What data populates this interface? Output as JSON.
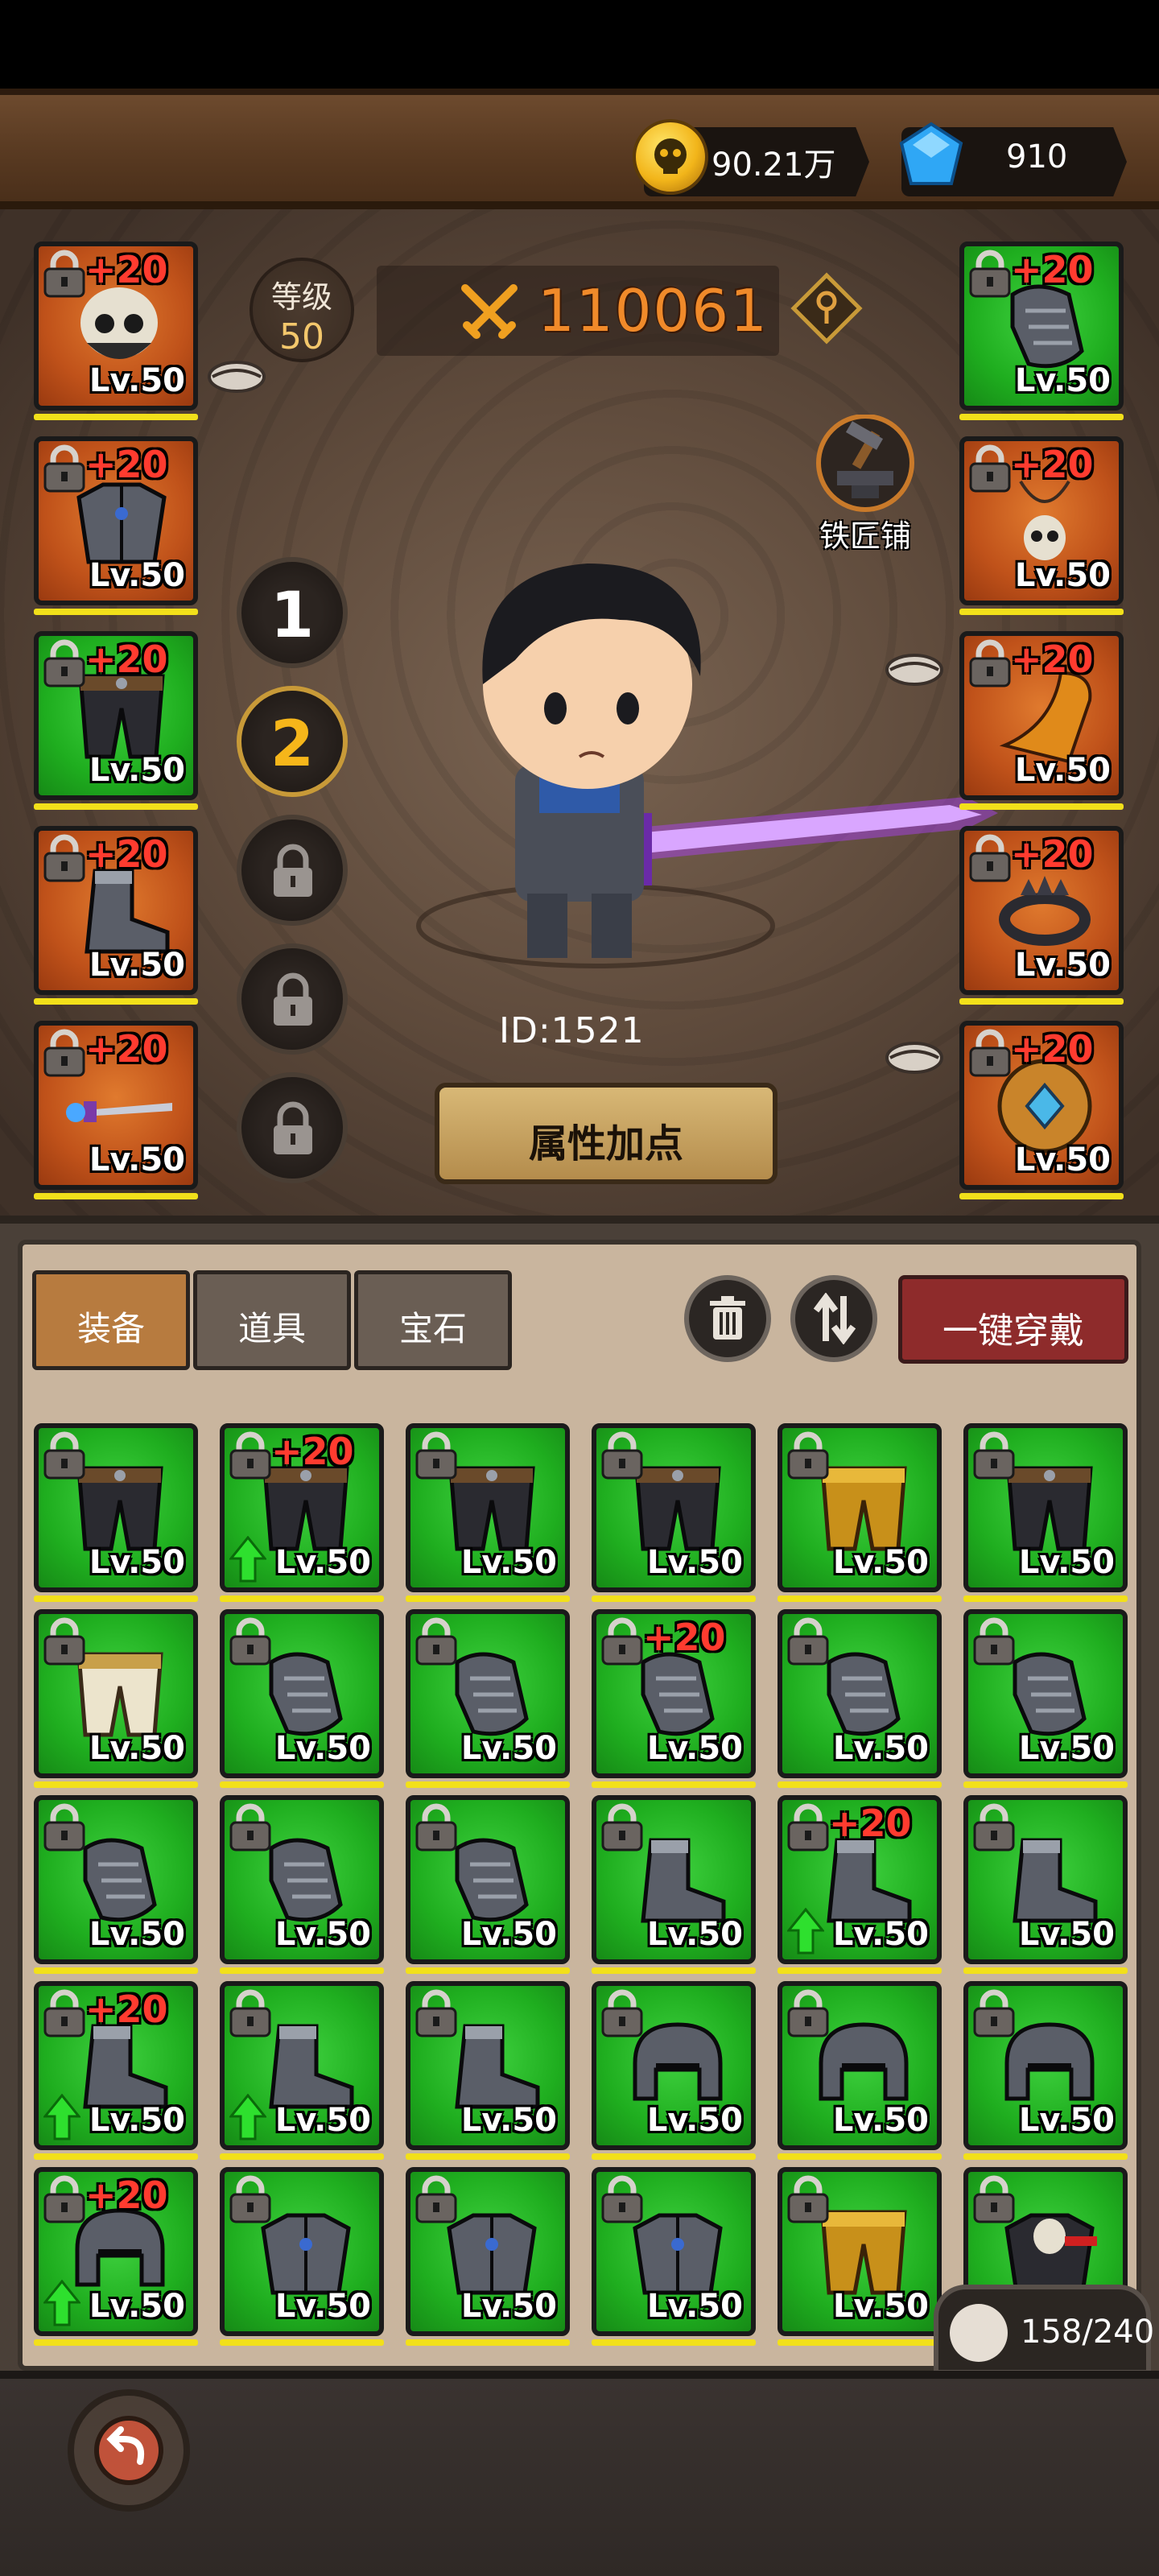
{
  "resources": {
    "gold": "90.21万",
    "gems": "910"
  },
  "hero": {
    "level_label": "等级",
    "level_value": "50",
    "combat_power": "110061",
    "id_text": "ID:1521",
    "attr_button": "属性加点",
    "blacksmith_label": "铁匠铺"
  },
  "presets": [
    "1",
    "2"
  ],
  "left_slots": [
    {
      "plus": "+20",
      "level": "Lv.50",
      "color": "orange",
      "icon": "skull-helmet-icon"
    },
    {
      "plus": "+20",
      "level": "Lv.50",
      "color": "orange",
      "icon": "chest-armor-icon"
    },
    {
      "plus": "+20",
      "level": "Lv.50",
      "color": "green",
      "icon": "pants-icon"
    },
    {
      "plus": "+20",
      "level": "Lv.50",
      "color": "orange",
      "icon": "boots-icon"
    },
    {
      "plus": "+20",
      "level": "Lv.50",
      "color": "orange",
      "icon": "sword-icon"
    }
  ],
  "right_slots": [
    {
      "plus": "+20",
      "level": "Lv.50",
      "color": "green",
      "icon": "gauntlet-icon"
    },
    {
      "plus": "+20",
      "level": "Lv.50",
      "color": "orange",
      "icon": "skull-necklace-icon"
    },
    {
      "plus": "+20",
      "level": "Lv.50",
      "color": "orange",
      "icon": "cape-icon"
    },
    {
      "plus": "+20",
      "level": "Lv.50",
      "color": "orange",
      "icon": "spiked-ring-icon"
    },
    {
      "plus": "+20",
      "level": "Lv.50",
      "color": "orange",
      "icon": "round-shield-icon"
    }
  ],
  "tabs": [
    "装备",
    "道具",
    "宝石"
  ],
  "equip_all": "一键穿戴",
  "capacity": "158/240",
  "bag_items": [
    {
      "plus": "",
      "level": "Lv.50",
      "icon": "pants-icon",
      "up": false
    },
    {
      "plus": "+20",
      "level": "Lv.50",
      "icon": "pants-icon",
      "up": true
    },
    {
      "plus": "",
      "level": "Lv.50",
      "icon": "pants-icon",
      "up": false
    },
    {
      "plus": "",
      "level": "Lv.50",
      "icon": "pants-icon",
      "up": false
    },
    {
      "plus": "",
      "level": "Lv.50",
      "icon": "gold-pants-icon",
      "up": false
    },
    {
      "plus": "",
      "level": "Lv.50",
      "icon": "pants-icon",
      "up": false
    },
    {
      "plus": "",
      "level": "Lv.50",
      "icon": "white-pants-icon",
      "up": false
    },
    {
      "plus": "",
      "level": "Lv.50",
      "icon": "gauntlet-icon",
      "up": false
    },
    {
      "plus": "",
      "level": "Lv.50",
      "icon": "gauntlet-icon",
      "up": false
    },
    {
      "plus": "+20",
      "level": "Lv.50",
      "icon": "gauntlet-icon",
      "up": false
    },
    {
      "plus": "",
      "level": "Lv.50",
      "icon": "gauntlet-icon",
      "up": false
    },
    {
      "plus": "",
      "level": "Lv.50",
      "icon": "gauntlet-icon",
      "up": false
    },
    {
      "plus": "",
      "level": "Lv.50",
      "icon": "gauntlet-icon",
      "up": false
    },
    {
      "plus": "",
      "level": "Lv.50",
      "icon": "gauntlet-icon",
      "up": false
    },
    {
      "plus": "",
      "level": "Lv.50",
      "icon": "gauntlet-icon",
      "up": false
    },
    {
      "plus": "",
      "level": "Lv.50",
      "icon": "boots-icon",
      "up": false
    },
    {
      "plus": "+20",
      "level": "Lv.50",
      "icon": "boots-icon",
      "up": true
    },
    {
      "plus": "",
      "level": "Lv.50",
      "icon": "boots-icon",
      "up": false
    },
    {
      "plus": "+20",
      "level": "Lv.50",
      "icon": "boots-icon",
      "up": true
    },
    {
      "plus": "",
      "level": "Lv.50",
      "icon": "boots-icon",
      "up": true
    },
    {
      "plus": "",
      "level": "Lv.50",
      "icon": "boots-icon",
      "up": false
    },
    {
      "plus": "",
      "level": "Lv.50",
      "icon": "helmet-icon",
      "up": false
    },
    {
      "plus": "",
      "level": "Lv.50",
      "icon": "helmet-icon",
      "up": false
    },
    {
      "plus": "",
      "level": "Lv.50",
      "icon": "helmet-icon",
      "up": false
    },
    {
      "plus": "+20",
      "level": "Lv.50",
      "icon": "helmet-icon",
      "up": true
    },
    {
      "plus": "",
      "level": "Lv.50",
      "icon": "chest-armor-icon",
      "up": false
    },
    {
      "plus": "",
      "level": "Lv.50",
      "icon": "chest-armor-icon",
      "up": false
    },
    {
      "plus": "",
      "level": "Lv.50",
      "icon": "chest-armor-icon",
      "up": false
    },
    {
      "plus": "",
      "level": "Lv.50",
      "icon": "gold-armor-icon",
      "up": false
    },
    {
      "plus": "",
      "level": "Lv.50",
      "icon": "skull-armor-icon",
      "up": false
    }
  ],
  "colors": {
    "orange_slot": "#c0521a",
    "green_slot": "#1fae1f",
    "plus_red": "#ff3b2f",
    "power_orange": "#f08a2a",
    "equip_all_red": "#8e2b2b",
    "active_tab": "#b77b3f"
  }
}
